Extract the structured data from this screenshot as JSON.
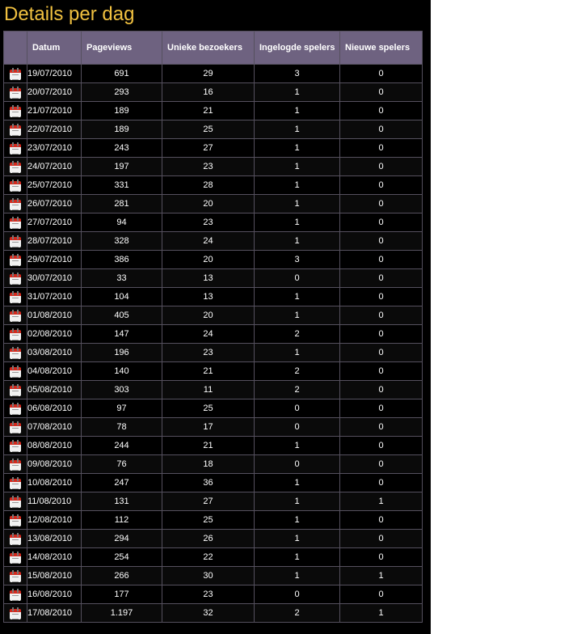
{
  "page": {
    "title": "Details per dag"
  },
  "table": {
    "headers": [
      "Datum",
      "Pageviews",
      "Unieke bezoekers",
      "Ingelogde spelers",
      "Nieuwe spelers"
    ],
    "row_icon": "calendar-icon",
    "rows": [
      {
        "datum": "19/07/2010",
        "pageviews": "691",
        "unieke": "29",
        "ingelogde": "3",
        "nieuwe": "0"
      },
      {
        "datum": "20/07/2010",
        "pageviews": "293",
        "unieke": "16",
        "ingelogde": "1",
        "nieuwe": "0"
      },
      {
        "datum": "21/07/2010",
        "pageviews": "189",
        "unieke": "21",
        "ingelogde": "1",
        "nieuwe": "0"
      },
      {
        "datum": "22/07/2010",
        "pageviews": "189",
        "unieke": "25",
        "ingelogde": "1",
        "nieuwe": "0"
      },
      {
        "datum": "23/07/2010",
        "pageviews": "243",
        "unieke": "27",
        "ingelogde": "1",
        "nieuwe": "0"
      },
      {
        "datum": "24/07/2010",
        "pageviews": "197",
        "unieke": "23",
        "ingelogde": "1",
        "nieuwe": "0"
      },
      {
        "datum": "25/07/2010",
        "pageviews": "331",
        "unieke": "28",
        "ingelogde": "1",
        "nieuwe": "0"
      },
      {
        "datum": "26/07/2010",
        "pageviews": "281",
        "unieke": "20",
        "ingelogde": "1",
        "nieuwe": "0"
      },
      {
        "datum": "27/07/2010",
        "pageviews": "94",
        "unieke": "23",
        "ingelogde": "1",
        "nieuwe": "0"
      },
      {
        "datum": "28/07/2010",
        "pageviews": "328",
        "unieke": "24",
        "ingelogde": "1",
        "nieuwe": "0"
      },
      {
        "datum": "29/07/2010",
        "pageviews": "386",
        "unieke": "20",
        "ingelogde": "3",
        "nieuwe": "0"
      },
      {
        "datum": "30/07/2010",
        "pageviews": "33",
        "unieke": "13",
        "ingelogde": "0",
        "nieuwe": "0"
      },
      {
        "datum": "31/07/2010",
        "pageviews": "104",
        "unieke": "13",
        "ingelogde": "1",
        "nieuwe": "0"
      },
      {
        "datum": "01/08/2010",
        "pageviews": "405",
        "unieke": "20",
        "ingelogde": "1",
        "nieuwe": "0"
      },
      {
        "datum": "02/08/2010",
        "pageviews": "147",
        "unieke": "24",
        "ingelogde": "2",
        "nieuwe": "0"
      },
      {
        "datum": "03/08/2010",
        "pageviews": "196",
        "unieke": "23",
        "ingelogde": "1",
        "nieuwe": "0"
      },
      {
        "datum": "04/08/2010",
        "pageviews": "140",
        "unieke": "21",
        "ingelogde": "2",
        "nieuwe": "0"
      },
      {
        "datum": "05/08/2010",
        "pageviews": "303",
        "unieke": "11",
        "ingelogde": "2",
        "nieuwe": "0"
      },
      {
        "datum": "06/08/2010",
        "pageviews": "97",
        "unieke": "25",
        "ingelogde": "0",
        "nieuwe": "0"
      },
      {
        "datum": "07/08/2010",
        "pageviews": "78",
        "unieke": "17",
        "ingelogde": "0",
        "nieuwe": "0"
      },
      {
        "datum": "08/08/2010",
        "pageviews": "244",
        "unieke": "21",
        "ingelogde": "1",
        "nieuwe": "0"
      },
      {
        "datum": "09/08/2010",
        "pageviews": "76",
        "unieke": "18",
        "ingelogde": "0",
        "nieuwe": "0"
      },
      {
        "datum": "10/08/2010",
        "pageviews": "247",
        "unieke": "36",
        "ingelogde": "1",
        "nieuwe": "0"
      },
      {
        "datum": "11/08/2010",
        "pageviews": "131",
        "unieke": "27",
        "ingelogde": "1",
        "nieuwe": "1"
      },
      {
        "datum": "12/08/2010",
        "pageviews": "112",
        "unieke": "25",
        "ingelogde": "1",
        "nieuwe": "0"
      },
      {
        "datum": "13/08/2010",
        "pageviews": "294",
        "unieke": "26",
        "ingelogde": "1",
        "nieuwe": "0"
      },
      {
        "datum": "14/08/2010",
        "pageviews": "254",
        "unieke": "22",
        "ingelogde": "1",
        "nieuwe": "0"
      },
      {
        "datum": "15/08/2010",
        "pageviews": "266",
        "unieke": "30",
        "ingelogde": "1",
        "nieuwe": "1"
      },
      {
        "datum": "16/08/2010",
        "pageviews": "177",
        "unieke": "23",
        "ingelogde": "0",
        "nieuwe": "0"
      },
      {
        "datum": "17/08/2010",
        "pageviews": "1.197",
        "unieke": "32",
        "ingelogde": "2",
        "nieuwe": "1"
      }
    ]
  },
  "colors": {
    "background": "#000000",
    "title": "#f0c040",
    "header_bg": "#6e6280",
    "text": "#ffffff",
    "border": "#55505e",
    "calendar_red": "#d42a1e"
  }
}
